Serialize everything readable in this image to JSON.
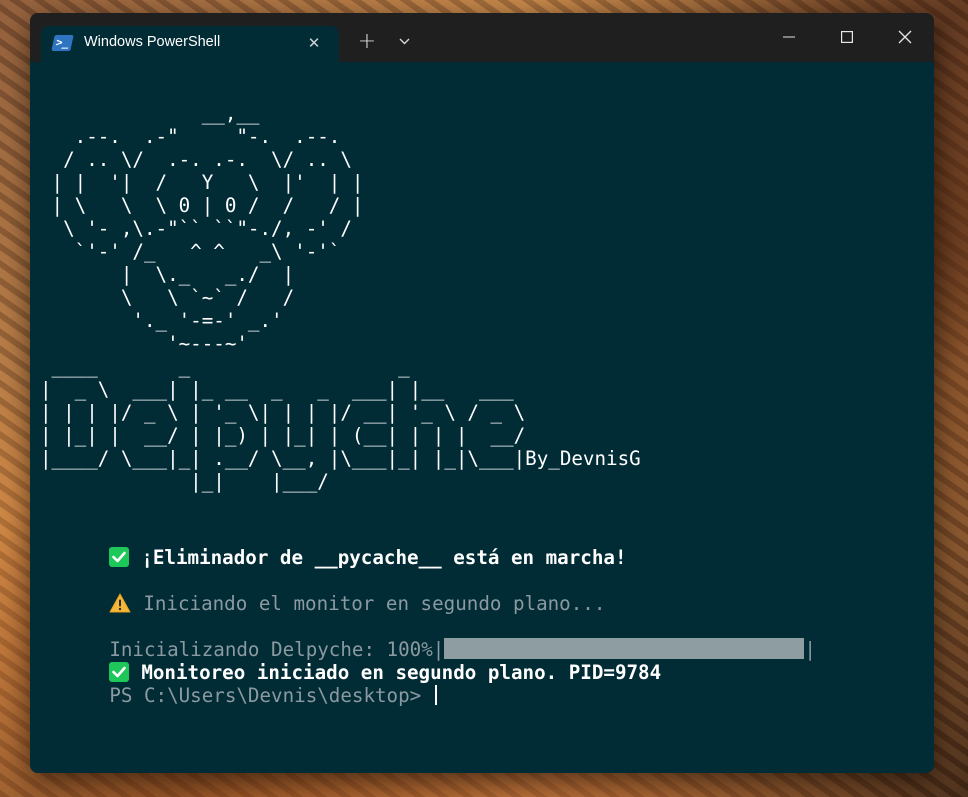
{
  "window": {
    "tab_title": "Windows PowerShell",
    "tab_icon": "powershell-icon",
    "colors": {
      "terminal_bg": "#012b35",
      "titlebar_bg": "#1f1f1f",
      "check_green": "#1ec75a",
      "warn_yellow": "#f4b73a",
      "progress_fill": "#8e9da2"
    }
  },
  "terminal": {
    "ascii_art": [
      "              __,__",
      "   .--.  .-\"     \"-.  .--.",
      "  / .. \\/  .-. .-.  \\/ .. \\",
      " | |  '|  /   Y   \\  |'  | |",
      " | \\   \\  \\ 0 | 0 /  /   / |",
      "  \\ '- ,\\.-\"`` ``\"-./, -' /",
      "   `'-' /_   ^ ^   _\\ '-'`",
      "       |  \\._   _./  |",
      "       \\   \\ `~` /   /",
      "        '._ '-=-' _.'",
      "           '~---~'"
    ],
    "banner": [
      " ____       _                  _",
      "|  _ \\  ___| |_ __  _   _  ___| |__   ___",
      "| | | |/ _ \\ | '_ \\| | | |/ __| '_ \\ / _ \\",
      "| |_| |  __/ | |_) | |_| | (__| | | |  __/",
      "|____/ \\___|_| .__/ \\__, |\\___|_| |_|\\___|By_DevnisG",
      "             |_|    |___/"
    ],
    "line_running": "¡Eliminador de __pycache__ está en marcha!",
    "line_starting": "Iniciando el monitor en segundo plano...",
    "progress": {
      "label": "Inicializando Delpyche: 100%|",
      "end": "|",
      "percent": 100
    },
    "line_started": "Monitoreo iniciado en segundo plano. PID=9784",
    "prompt": "PS C:\\Users\\Devnis\\desktop> "
  }
}
